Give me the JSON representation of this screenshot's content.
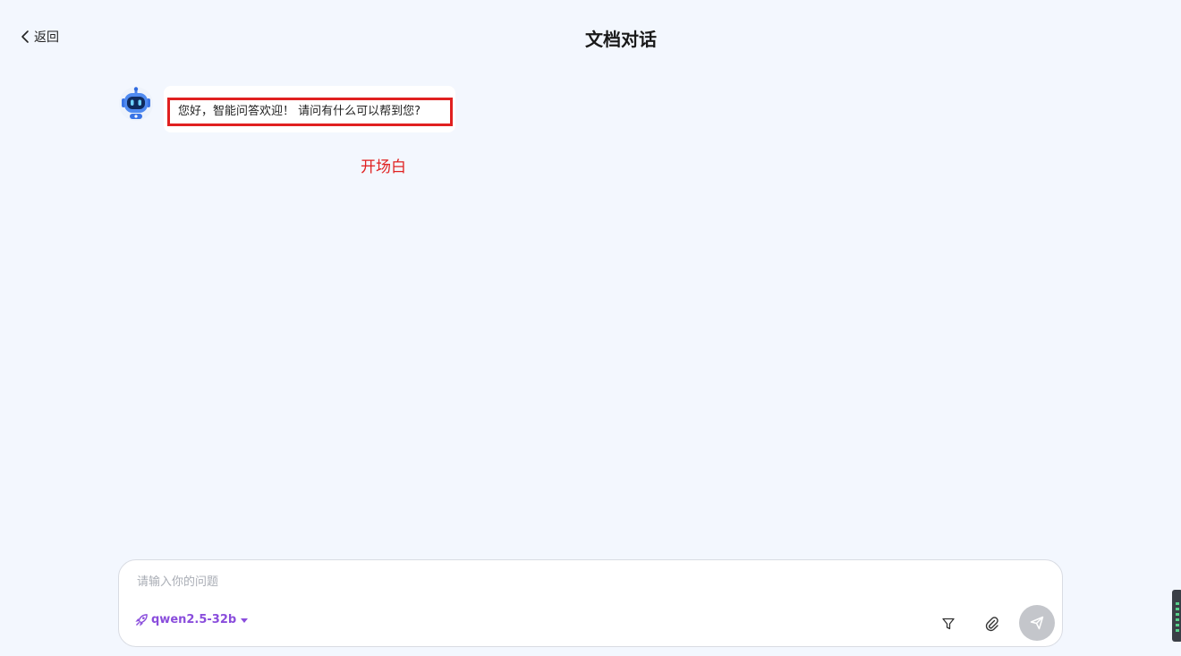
{
  "header": {
    "back_label": "返回",
    "title": "文档对话"
  },
  "chat": {
    "messages": [
      {
        "role": "assistant",
        "text": "您好，智能问答欢迎！ 请问有什么可以帮到您?"
      }
    ],
    "annotation": "开场白"
  },
  "composer": {
    "placeholder": "请输入你的问题",
    "value": "",
    "model_label": "qwen2.5-32b"
  },
  "colors": {
    "background": "#f3f7fe",
    "highlight": "#e02020",
    "model_accent": "#8a4ddc",
    "send_disabled": "#c4c6cb"
  },
  "icons": {
    "back": "chevron-left-icon",
    "avatar": "robot-avatar-icon",
    "model": "rocket-icon",
    "model_dropdown": "caret-down-icon",
    "filter": "filter-icon",
    "attach": "paperclip-icon",
    "send": "send-icon"
  }
}
